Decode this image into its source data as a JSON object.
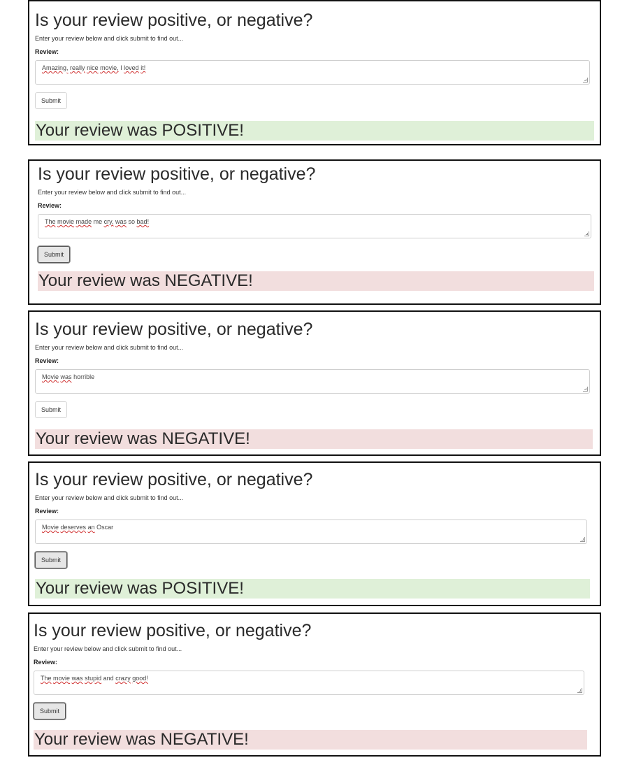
{
  "panels": [
    {
      "title": "Is your review positive, or negative?",
      "instructions": "Enter your review below and click submit to find out...",
      "review_label": "Review:",
      "review_words": [
        "Amazing,",
        "really",
        "nice",
        "movie,",
        "I",
        "loved",
        "it!"
      ],
      "submit_label": "Submit",
      "submit_pressed": false,
      "result_text": "Your review was POSITIVE!",
      "result_color": "#dff0d8"
    },
    {
      "title": "Is your review positive, or negative?",
      "instructions": "Enter your review below and click submit to find out...",
      "review_label": "Review:",
      "review_words": [
        "The",
        "movie",
        "made",
        "me",
        "cry,",
        "was",
        "so",
        "bad!"
      ],
      "submit_label": "Submit",
      "submit_pressed": true,
      "result_text": "Your review was NEGATIVE!",
      "result_color": "#f2dede"
    },
    {
      "title": "Is your review positive, or negative?",
      "instructions": "Enter your review below and click submit to find out...",
      "review_label": "Review:",
      "review_words": [
        "Movie",
        "was",
        "horrible"
      ],
      "submit_label": "Submit",
      "submit_pressed": false,
      "result_text": "Your review was NEGATIVE!",
      "result_color": "#f2dede"
    },
    {
      "title": "Is your review positive, or negative?",
      "instructions": "Enter your review below and click submit to find out...",
      "review_label": "Review:",
      "review_words": [
        "Movie",
        "deserves",
        "an",
        "Oscar"
      ],
      "submit_label": "Submit",
      "submit_pressed": true,
      "result_text": "Your review was POSITIVE!",
      "result_color": "#dff0d8"
    },
    {
      "title": "Is your review positive, or negative?",
      "instructions": "Enter your review below and click submit to find out...",
      "review_label": "Review:",
      "review_words": [
        "The",
        "movie",
        "was",
        "stupid",
        "and",
        "crazy",
        "good!"
      ],
      "submit_label": "Submit",
      "submit_pressed": true,
      "result_text": "Your review was NEGATIVE!",
      "result_color": "#f2dede"
    }
  ]
}
